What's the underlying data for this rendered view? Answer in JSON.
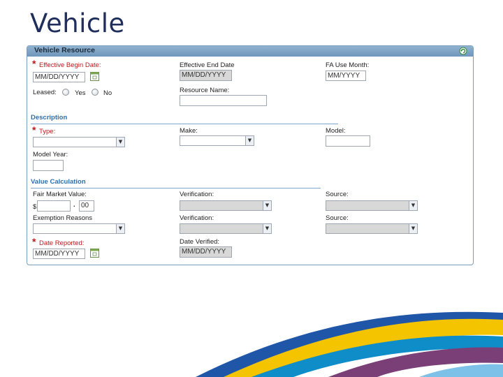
{
  "slide": {
    "title": "Vehicle"
  },
  "panel": {
    "title": "Vehicle Resource",
    "header_icon": "refresh-icon",
    "fields": {
      "effective_begin_date": {
        "label": "Effective Begin Date:",
        "placeholder": "MM/DD/YYYY",
        "required": true
      },
      "effective_end_date": {
        "label": "Effective End Date",
        "placeholder": "MM/DD/YYYY"
      },
      "fa_use_month": {
        "label": "FA Use Month:",
        "placeholder": "MM/YYYY"
      },
      "leased": {
        "label": "Leased:",
        "yes": "Yes",
        "no": "No"
      },
      "resource_name": {
        "label": "Resource Name:",
        "value": ""
      },
      "type": {
        "label": "Type:",
        "required": true
      },
      "make": {
        "label": "Make:"
      },
      "model": {
        "label": "Model:"
      },
      "model_year": {
        "label": "Model Year:"
      },
      "fair_market_value": {
        "label": "Fair Market Value:",
        "currency": "$",
        "decimal_sep": ".",
        "cents": "00"
      },
      "verification_1": {
        "label": "Verification:"
      },
      "source_1": {
        "label": "Source:"
      },
      "exemption_reasons": {
        "label": "Exemption Reasons"
      },
      "verification_2": {
        "label": "Verification:"
      },
      "source_2": {
        "label": "Source:"
      },
      "date_reported": {
        "label": "Date Reported:",
        "placeholder": "MM/DD/YYYY",
        "required": true
      },
      "date_verified": {
        "label": "Date Verified:",
        "placeholder": "MM/DD/YYYY"
      }
    },
    "sections": {
      "description": "Description",
      "value_calculation": "Value Calculation"
    }
  },
  "colors": {
    "title": "#1f2e5a",
    "accent": "#2f6fad",
    "required": "#c0171b"
  }
}
